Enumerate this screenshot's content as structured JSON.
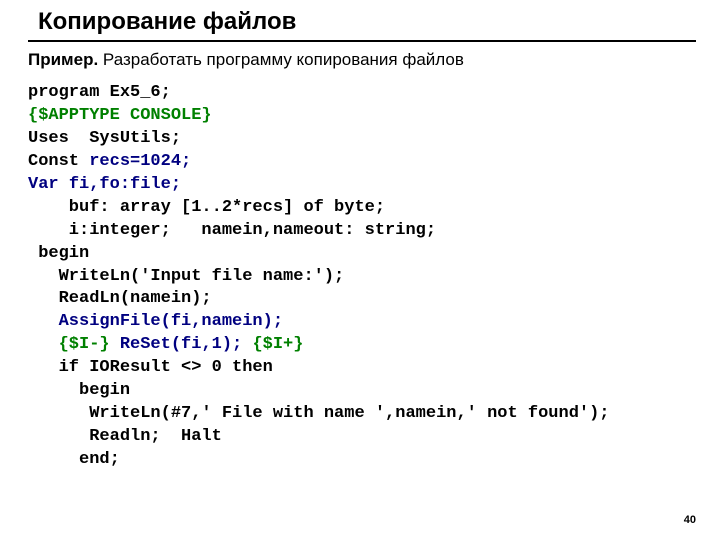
{
  "title": "Копирование файлов",
  "subtitle_bold": "Пример.",
  "subtitle_rest": " Разработать программу копирования файлов",
  "code": {
    "l1_a": "program ",
    "l1_b": "Ex5_6;",
    "l2": "{$APPTYPE CONSOLE}",
    "l3_a": "Uses ",
    "l3_b": " SysUtils;",
    "l4_a": "Const ",
    "l4_b": "recs=1024;",
    "l5_a": "Var ",
    "l5_b": "fi,fo:file;",
    "l6": "    buf: array [1..2*recs] of byte;",
    "l7": "    i:integer;   namein,nameout: string;",
    "l8": " begin",
    "l9": "   WriteLn('Input file name:');",
    "l10": "   ReadLn(namein);",
    "l11": "   AssignFile(fi,namein);",
    "l12_a": "   {$I-} ",
    "l12_b": "ReSet(fi,1); ",
    "l12_c": "{$I+}",
    "l13": "   if IOResult <> 0 then",
    "l14": "     begin",
    "l15": "      WriteLn(#7,' File with name ',namein,' not found');",
    "l16": "      Readln;  Halt",
    "l17": "     end;"
  },
  "page_number": "40"
}
